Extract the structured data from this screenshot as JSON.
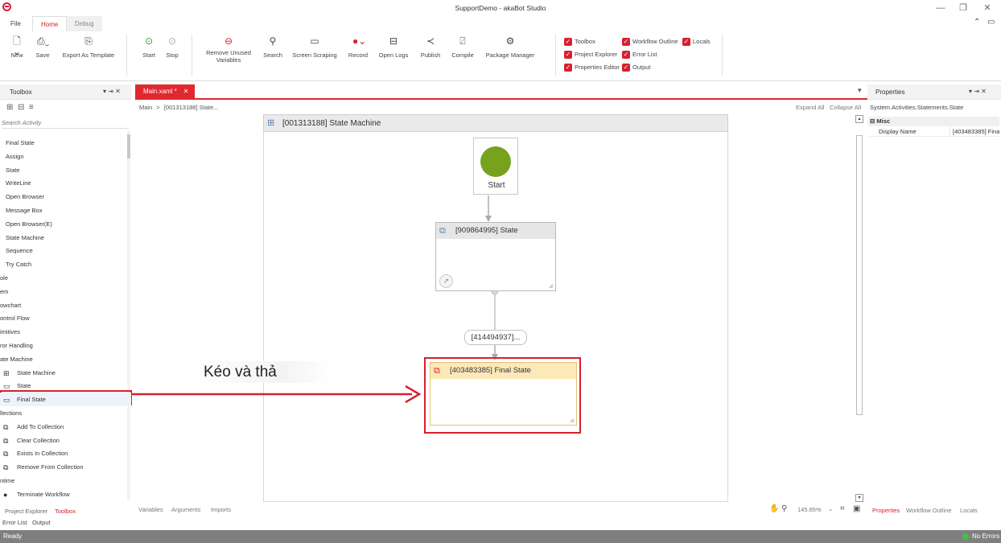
{
  "window": {
    "title": "SupportDemo - akaBot Studio",
    "minimize": "—",
    "maximize": "❐",
    "close": "✕"
  },
  "menu_tabs": [
    "File",
    "Home",
    "Debug"
  ],
  "ribbon": {
    "new": "New",
    "save": "Save",
    "export": "Export As Template",
    "start": "Start",
    "stop": "Stop",
    "remove_unused_1": "Remove Unused",
    "remove_unused_2": "Variables",
    "search": "Search",
    "screen_scraping": "Screen Scraping",
    "record": "Record",
    "open_logs": "Open Logs",
    "publish": "Publish",
    "compile": "Compile",
    "package_manager": "Package Manager",
    "checks": {
      "toolbox": "Toolbox",
      "workflow_outline": "Workflow Outline",
      "locals": "Locals",
      "project_explorer": "Project Explorer",
      "error_list": "Error List",
      "properties_editor": "Properties Editor",
      "output": "Output"
    }
  },
  "toolbox": {
    "title": "Toolbox",
    "header_icons": "▾ ⇥ ✕",
    "search_placeholder": "Search Activity",
    "items": [
      {
        "label": "Final State",
        "icon": ""
      },
      {
        "label": "Assign",
        "icon": ""
      },
      {
        "label": "State",
        "icon": ""
      },
      {
        "label": "WriteLine",
        "icon": ""
      },
      {
        "label": "Open Browser",
        "icon": ""
      },
      {
        "label": "Message Box",
        "icon": ""
      },
      {
        "label": "Open Browser(E)",
        "icon": ""
      },
      {
        "label": "State Machine",
        "icon": ""
      },
      {
        "label": "Sequence",
        "icon": ""
      },
      {
        "label": "Try Catch",
        "icon": ""
      },
      {
        "label": "ole",
        "icon": "",
        "cat": true
      },
      {
        "label": "em",
        "icon": "",
        "cat": true
      },
      {
        "label": "owchart",
        "icon": "",
        "cat": true
      },
      {
        "label": "ontrol Flow",
        "icon": "",
        "cat": true
      },
      {
        "label": "imitives",
        "icon": "",
        "cat": true
      },
      {
        "label": "ror Handling",
        "icon": "",
        "cat": true
      },
      {
        "label": "ate Machine",
        "icon": "",
        "cat": true
      },
      {
        "label": "State Machine",
        "icon": "⊞"
      },
      {
        "label": "State",
        "icon": "▭"
      },
      {
        "label": "Final State",
        "icon": "▭"
      },
      {
        "label": "llections",
        "icon": "",
        "cat": true
      },
      {
        "label": "Add To Collection",
        "icon": "⧉"
      },
      {
        "label": "Clear Collection",
        "icon": "⧉"
      },
      {
        "label": "Exists In Collection",
        "icon": "⧉"
      },
      {
        "label": "Remove From Collection",
        "icon": "⧉"
      },
      {
        "label": "ntime",
        "icon": "",
        "cat": true
      },
      {
        "label": "Terminate Workflow",
        "icon": "●"
      }
    ]
  },
  "left_bottom_tabs": {
    "project_explorer": "Project Explorer",
    "toolbox": "Toolbox",
    "error_list": "Error List",
    "output": "Output"
  },
  "document": {
    "tab": "Main.xaml *",
    "breadcrumb_main": "Main",
    "breadcrumb_arrow": ">",
    "breadcrumb_item": "[001313188] State...",
    "expand_all": "Expand All",
    "collapse_all": "Collapse All"
  },
  "designer": {
    "machine_title": "[001313188] State Machine",
    "start_label": "Start",
    "state_title": "[909864995] State",
    "transition_label": "[414494937]...",
    "final_state_title": "[403483385] Final State",
    "annotation": "Kéo và thả"
  },
  "designer_bottom": {
    "variables": "Variables",
    "arguments": "Arguments",
    "imports": "Imports",
    "zoom": "145.65%"
  },
  "properties": {
    "title": "Properties",
    "type": "System.Activities.Statements.State",
    "misc": "Misc",
    "display_name_label": "Display Name",
    "display_name_value": "[403483385] Fina"
  },
  "right_bottom_tabs": {
    "properties": "Properties",
    "workflow_outline": "Workflow Outline",
    "locals": "Locals"
  },
  "status": {
    "left": "Ready",
    "right": "No Errors"
  },
  "colors": {
    "accent": "#e0282f",
    "start_node": "#76a21e",
    "final_fill": "#fbe9b8"
  }
}
